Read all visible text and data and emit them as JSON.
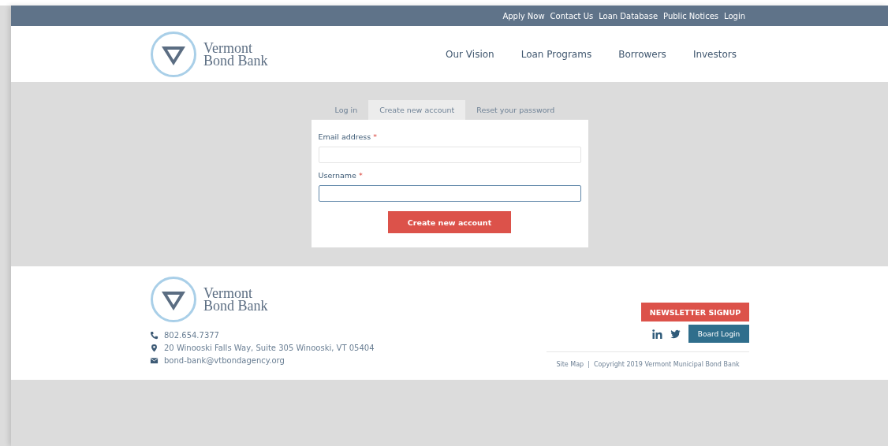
{
  "top_bar": {
    "links": [
      "Apply Now",
      "Contact Us",
      "Loan Database",
      "Public Notices",
      "Login"
    ]
  },
  "header": {
    "logo_text": "Vermont Bond Bank",
    "nav": [
      "Our Vision",
      "Loan Programs",
      "Borrowers",
      "Investors"
    ]
  },
  "tabs": [
    {
      "label": "Log in",
      "selected": false
    },
    {
      "label": "Create new account",
      "selected": true
    },
    {
      "label": "Reset your password",
      "selected": false
    }
  ],
  "form": {
    "fields": [
      {
        "label": "Email address",
        "required_mark": "*",
        "focused": false
      },
      {
        "label": "Username",
        "required_mark": "*",
        "focused": true
      }
    ],
    "submit": "Create new account"
  },
  "footer": {
    "logo_text": "Vermont Bond Bank",
    "contacts": [
      {
        "kind": "phone",
        "text": "802.654.7377"
      },
      {
        "kind": "location",
        "text": "20 Winooski Falls Way, Suite 305 Winooski, VT 05404"
      },
      {
        "kind": "email",
        "text": "bond-bank@vtbondagency.org"
      }
    ],
    "newsletter": "NEWSLETTER SIGNUP",
    "board_login": "Board Login",
    "site_map": "Site Map",
    "separator": "|",
    "copyright": "Copyright 2019 Vermont Municipal Bond Bank"
  }
}
